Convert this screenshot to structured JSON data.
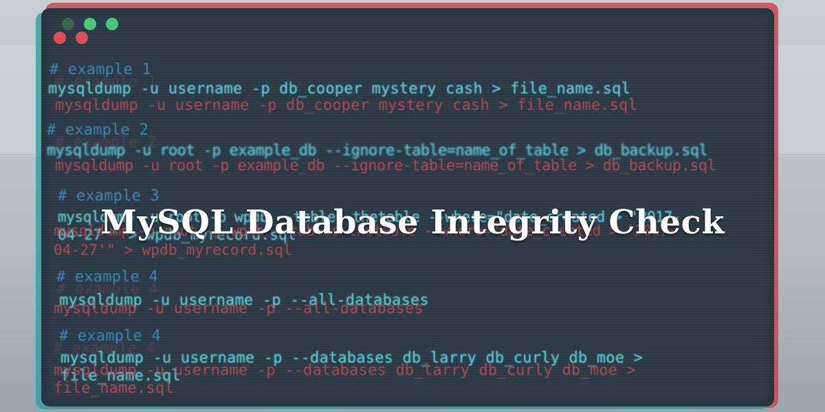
{
  "page_title": "MySQL Database Integrity Check",
  "window": {
    "dots": [
      {
        "name": "close",
        "color": "#e34a56"
      },
      {
        "name": "minimize",
        "color": "#e34a56"
      },
      {
        "name": "maximize-dim",
        "color": "#4a7a5a"
      },
      {
        "name": "maximize",
        "color": "#48c77a"
      },
      {
        "name": "zoom",
        "color": "#48c77a"
      }
    ]
  },
  "examples": [
    {
      "comment": "# example 1",
      "command": "mysqldump -u username -p db_cooper mystery cash > file_name.sql"
    },
    {
      "comment": "# example 2",
      "command": "mysqldump -u root -p example_db --ignore-table=name_of_table > db_backup.sql"
    },
    {
      "comment": "# example 3",
      "command_line1": "mysqldump -u root -p wpdb --tables thetable --where=\"date_created > '2017-",
      "command_line2": "04-27'\" > wpdb_myrecord.sql"
    },
    {
      "comment": "# example 4",
      "command": "mysqldump -u username -p --all-databases"
    },
    {
      "comment": "# example 4",
      "command_line1": "mysqldump -u username -p --databases db_larry db_curly db_moe >",
      "command_line2": "file_name.sql"
    }
  ]
}
